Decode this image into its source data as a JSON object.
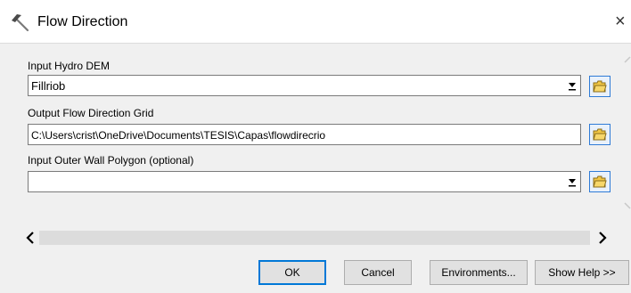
{
  "window": {
    "title": "Flow Direction",
    "close_label": "×"
  },
  "fields": [
    {
      "label": "Input Hydro DEM",
      "value": "Fillriob",
      "type": "combo"
    },
    {
      "label": "Output Flow Direction Grid",
      "value": "C:\\Users\\crist\\OneDrive\\Documents\\TESIS\\Capas\\flowdirecrio",
      "type": "text"
    },
    {
      "label": "Input Outer Wall Polygon (optional)",
      "value": "",
      "type": "combo"
    }
  ],
  "buttons": {
    "ok": "OK",
    "cancel": "Cancel",
    "environments": "Environments...",
    "show_help": "Show Help >>"
  },
  "icons": {
    "title": "hammer-icon",
    "browse": "open-folder-icon",
    "dropdown": "dropdown-arrow-icon",
    "scroll_left": "scroll-left-arrow-icon",
    "scroll_right": "scroll-right-arrow-icon"
  },
  "colors": {
    "accent": "#0078d7",
    "folder": "#f2c744"
  }
}
